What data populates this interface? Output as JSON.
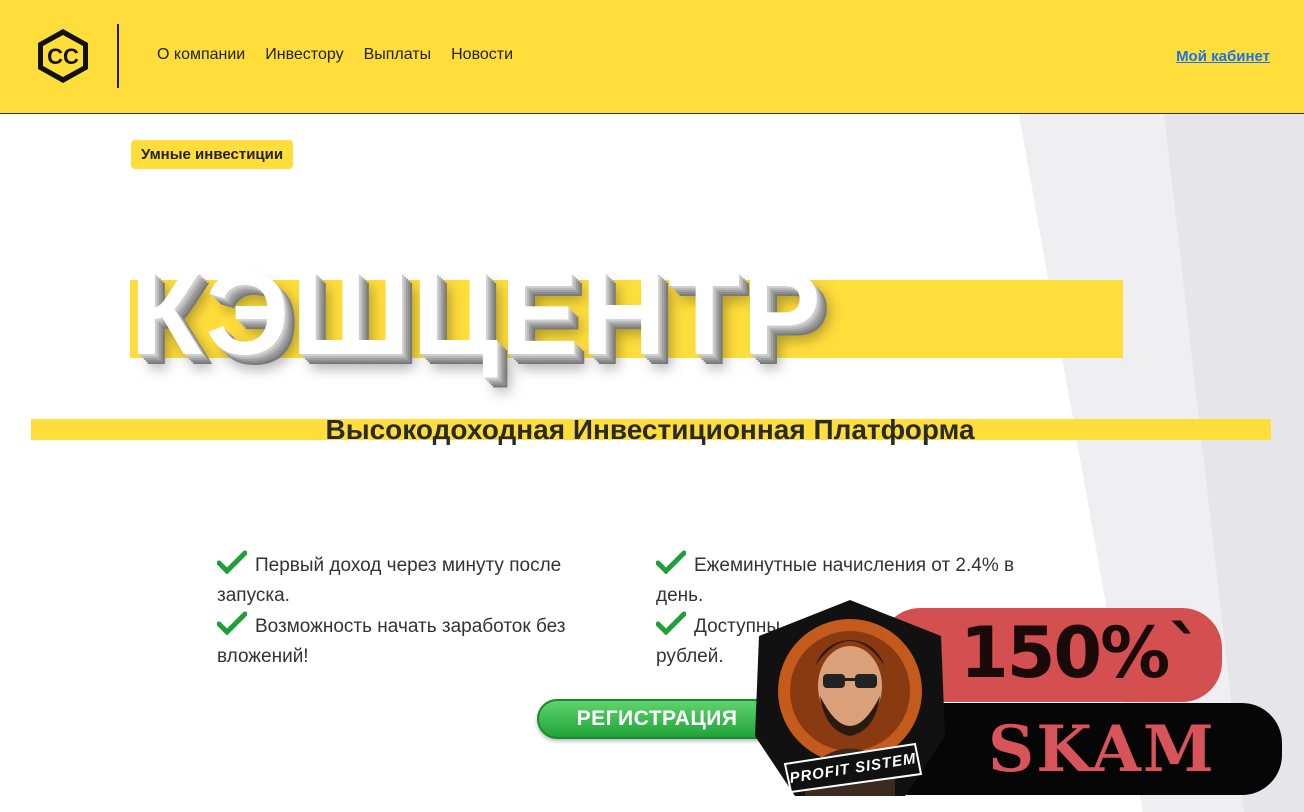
{
  "header": {
    "logo_text": "CC",
    "nav": [
      "О компании",
      "Инвестору",
      "Выплаты",
      "Новости"
    ],
    "cabinet_link": "Мой кабинет"
  },
  "hero": {
    "tag": "Умные инвестиции",
    "title": "КЭШЦЕНТР",
    "subtitle": "Высокодоходная Инвестиционная Платформа"
  },
  "features": {
    "left": [
      "Первый доход через минуту после запуска.",
      "Возможность начать заработок без вложений!"
    ],
    "right": [
      "Ежеминутные начисления от 2.4% в день.",
      "Доступны"
    ],
    "right_tail": "рублей."
  },
  "register_button": "РЕГИСТРАЦИЯ",
  "overlay": {
    "percent": "150%`",
    "scam": "SKAM",
    "brand": "PROFIT SISTEM"
  },
  "colors": {
    "brand_yellow": "#ffde3b",
    "link_blue": "#1a73e8",
    "button_green": "#20a33a",
    "badge_red": "#d44f4f"
  }
}
